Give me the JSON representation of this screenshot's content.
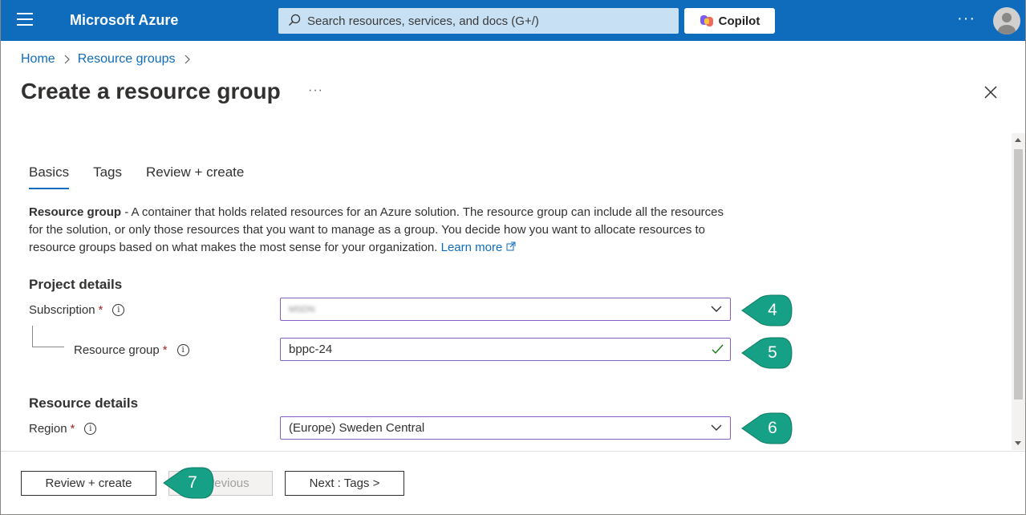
{
  "topbar": {
    "brand": "Microsoft Azure",
    "search_placeholder": "Search resources, services, and docs (G+/)",
    "copilot_label": "Copilot",
    "more": "···"
  },
  "breadcrumb": {
    "home": "Home",
    "resource_groups": "Resource groups"
  },
  "page": {
    "title": "Create a resource group",
    "more": "···"
  },
  "tabs": [
    {
      "label": "Basics",
      "active": true
    },
    {
      "label": "Tags",
      "active": false
    },
    {
      "label": "Review + create",
      "active": false
    }
  ],
  "description": {
    "lead": "Resource group",
    "body": " - A container that holds related resources for an Azure solution. The resource group can include all the resources for the solution, or only those resources that you want to manage as a group. You decide how you want to allocate resources to resource groups based on what makes the most sense for your organization.",
    "link": "Learn more"
  },
  "project_details": {
    "heading": "Project details",
    "subscription_label": "Subscription",
    "subscription_value": "MSDN",
    "resource_group_label": "Resource group",
    "resource_group_value": "bppc-24"
  },
  "resource_details": {
    "heading": "Resource details",
    "region_label": "Region",
    "region_value": "(Europe) Sweden Central"
  },
  "required_marker": "*",
  "info_glyph": "i",
  "callouts": [
    "4",
    "5",
    "6",
    "7"
  ],
  "footer": {
    "review_create": "Review + create",
    "previous": "< Previous",
    "next": "Next : Tags >"
  },
  "colors": {
    "accent": "#0f6cbd",
    "callout": "#16a085",
    "field_border": "#8661c5"
  }
}
